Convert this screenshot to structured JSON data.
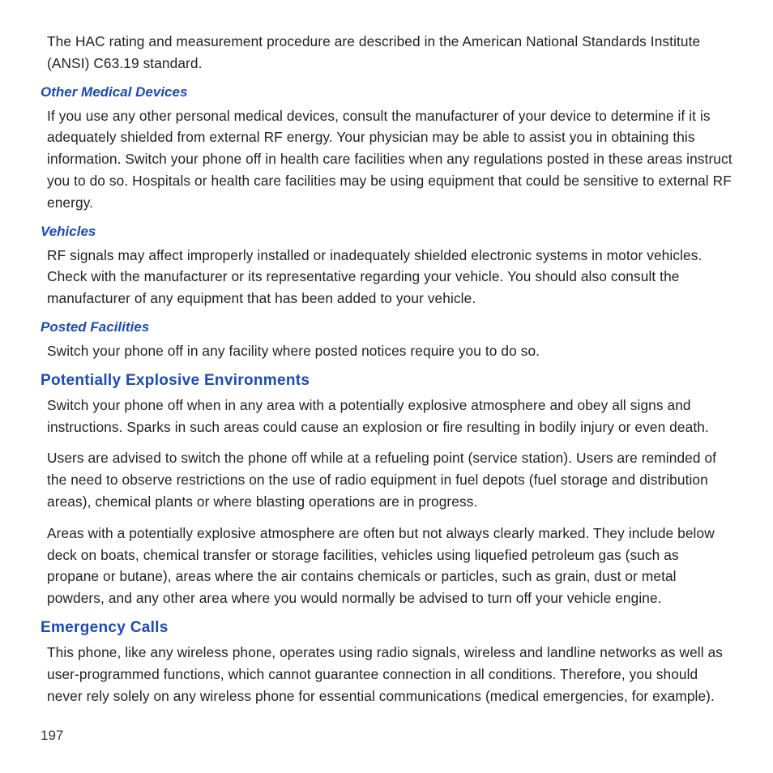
{
  "intro_paragraph": "The HAC rating and measurement procedure are described in the American National Standards Institute (ANSI) C63.19 standard.",
  "sections": {
    "other_medical": {
      "heading": "Other Medical Devices",
      "body": "If you use any other personal medical devices, consult the manufacturer of your device to determine if it is adequately shielded from external RF energy. Your physician may be able to assist you in obtaining this information. Switch your phone off in health care facilities when any regulations posted in these areas instruct you to do so. Hospitals or health care facilities may be using equipment that could be sensitive to external RF energy."
    },
    "vehicles": {
      "heading": "Vehicles",
      "body": "RF signals may affect improperly installed or inadequately shielded electronic systems in motor vehicles. Check with the manufacturer or its representative regarding your vehicle. You should also consult the manufacturer of any equipment that has been added to your vehicle."
    },
    "posted_facilities": {
      "heading": "Posted Facilities",
      "body": "Switch your phone off in any facility where posted notices require you to do so."
    },
    "explosive": {
      "heading": "Potentially Explosive Environments",
      "p1": "Switch your phone off when in any area with a potentially explosive atmosphere and obey all signs and instructions. Sparks in such areas could cause an explosion or fire resulting in bodily injury or even death.",
      "p2": "Users are advised to switch the phone off while at a refueling point (service station). Users are reminded of the need to observe restrictions on the use of radio equipment in fuel depots (fuel storage and distribution areas), chemical plants or where blasting operations are in progress.",
      "p3": "Areas with a potentially explosive atmosphere are often but not always clearly marked. They include below deck on boats, chemical transfer or storage facilities, vehicles using liquefied petroleum gas (such as propane or butane), areas where the air contains chemicals or particles, such as grain, dust or metal powders, and any other area where you would normally be advised to turn off your vehicle engine."
    },
    "emergency": {
      "heading": "Emergency Calls",
      "body": "This phone, like any wireless phone, operates using radio signals, wireless and landline networks as well as user-programmed functions, which cannot guarantee connection in all conditions. Therefore, you should never rely solely on any wireless phone for essential communications (medical emergencies, for example)."
    }
  },
  "page_number": "197"
}
